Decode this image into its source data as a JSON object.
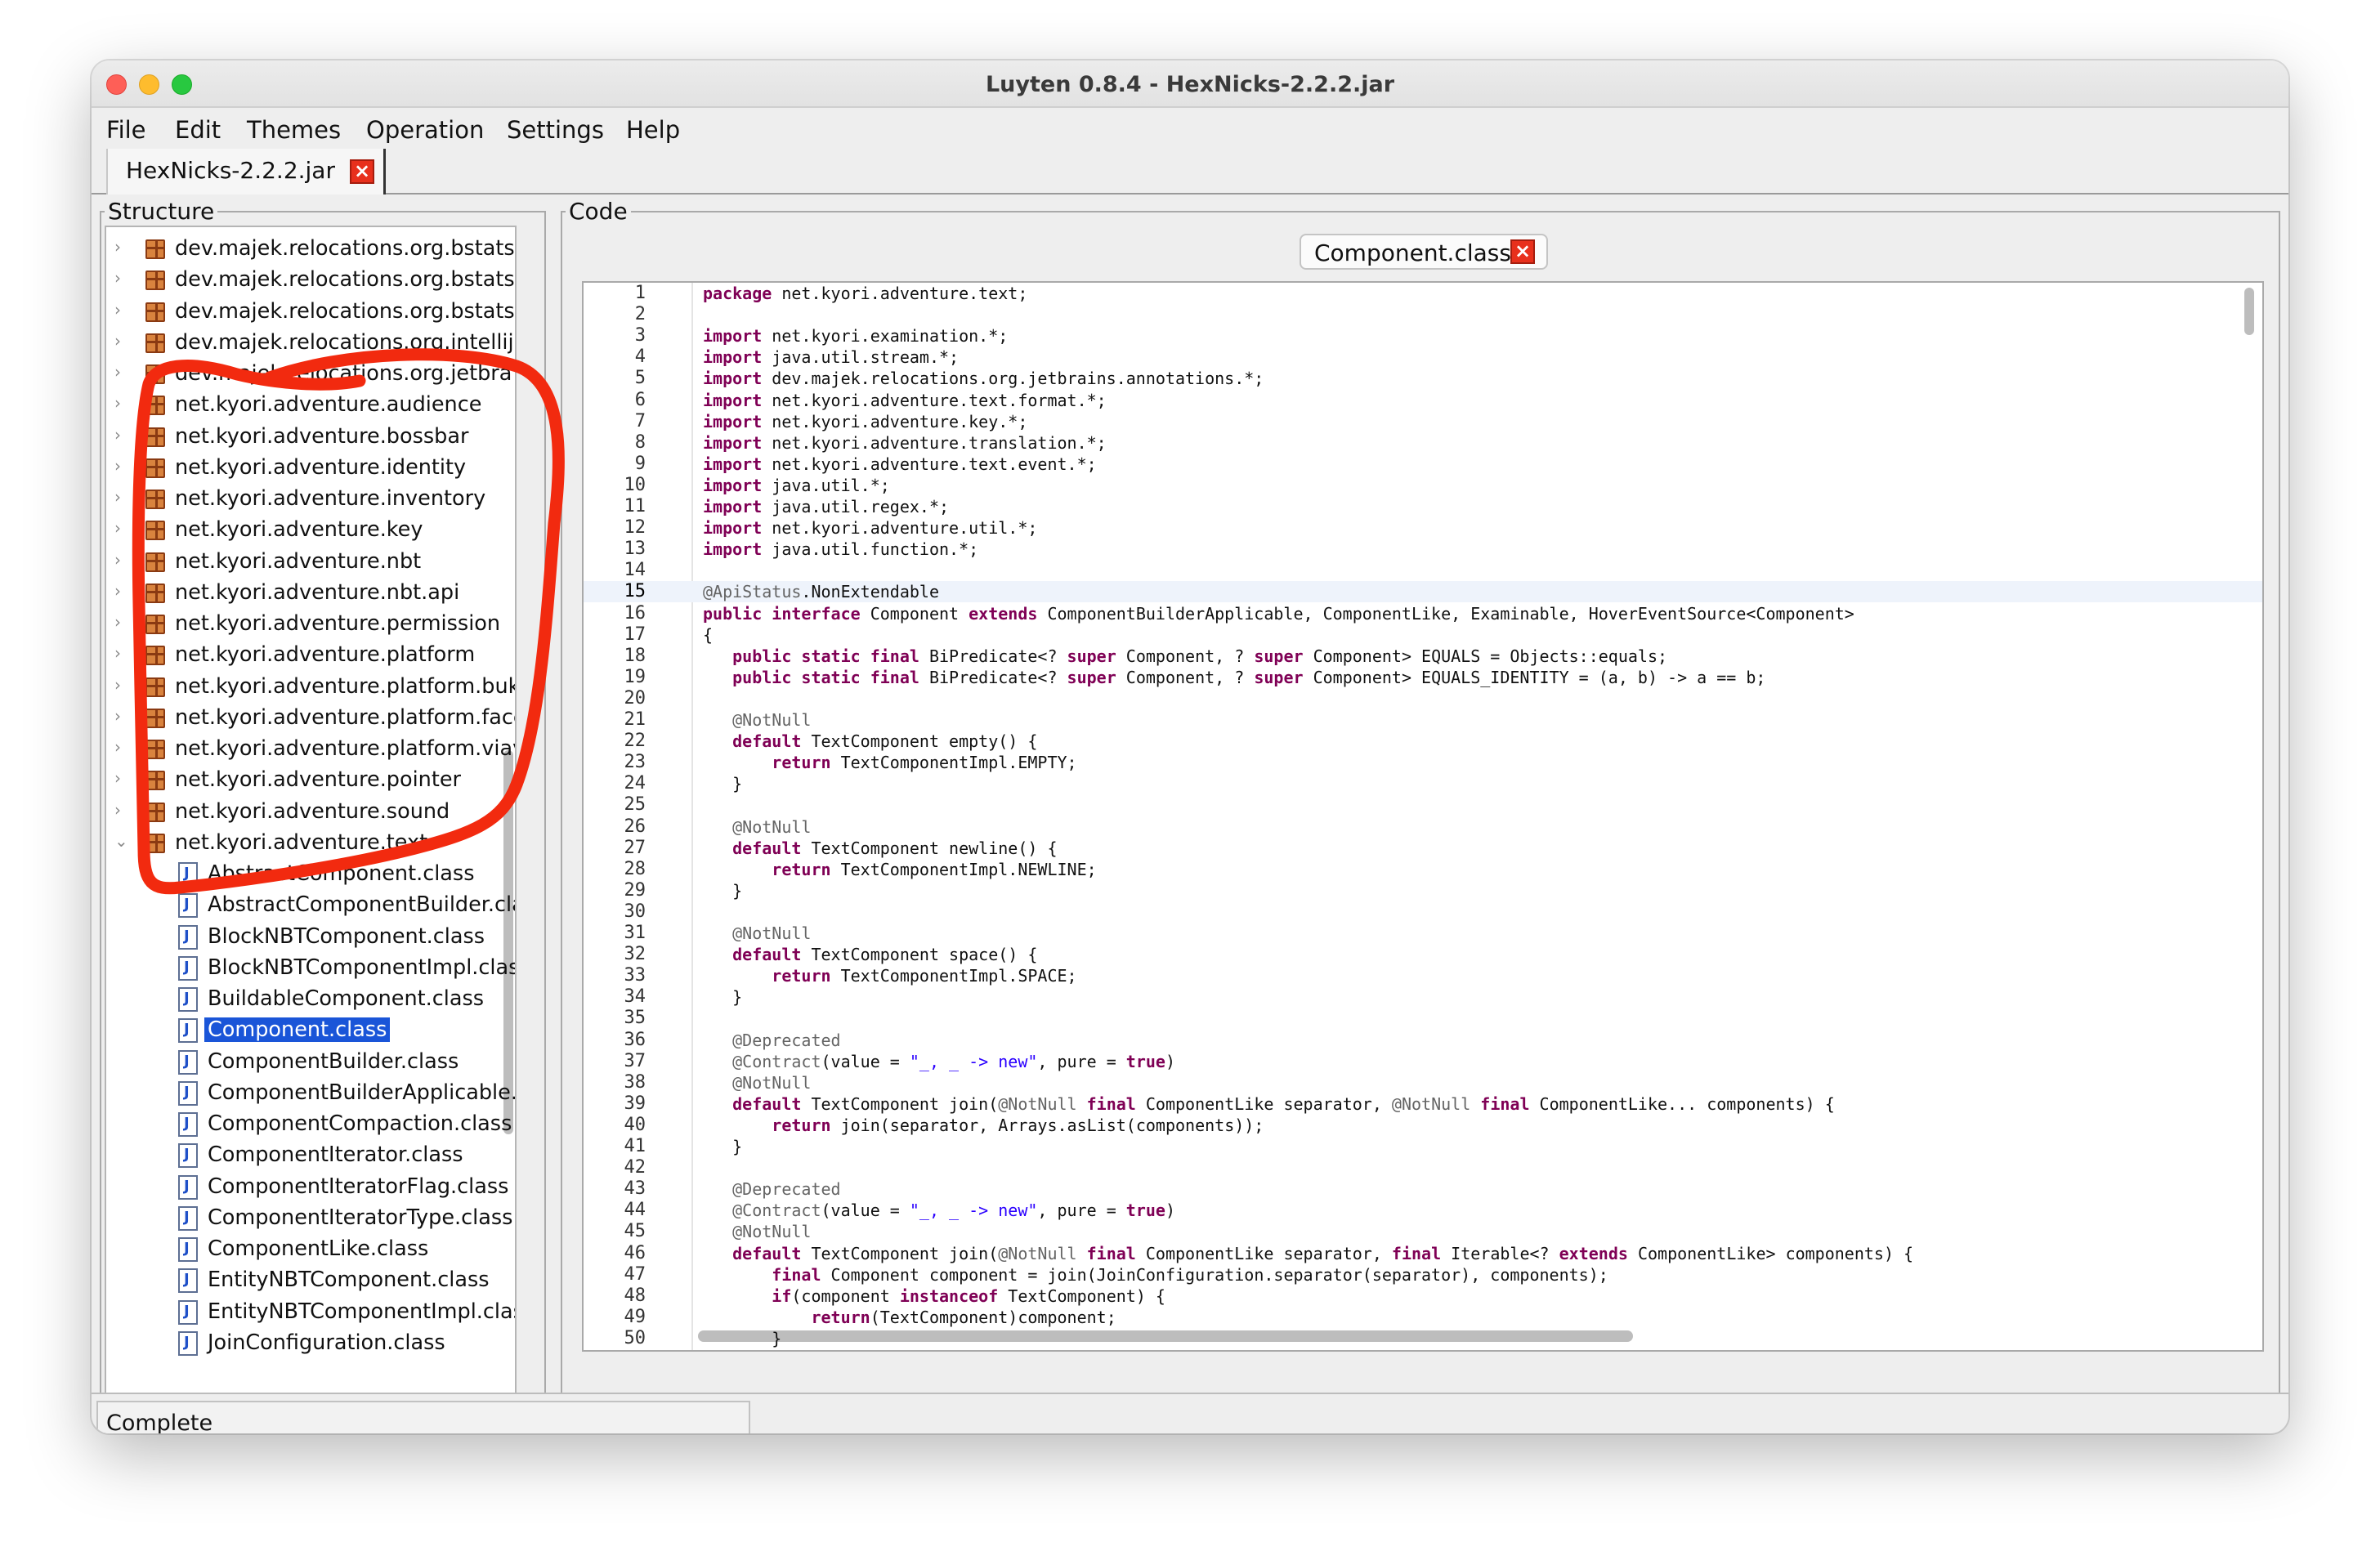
{
  "window": {
    "title": "Luyten 0.8.4 - HexNicks-2.2.2.jar"
  },
  "menu": [
    "File",
    "Edit",
    "Themes",
    "Operation",
    "Settings",
    "Help"
  ],
  "file_tab": {
    "label": "HexNicks-2.2.2.jar",
    "close": "×"
  },
  "structure": {
    "title": "Structure",
    "packages": [
      "dev.majek.relocations.org.bstats.b",
      "dev.majek.relocations.org.bstats.cl",
      "dev.majek.relocations.org.bstats.js",
      "dev.majek.relocations.org.intellij.la",
      "dev.majek.relocations.org.jetbra",
      "net.kyori.adventure.audience",
      "net.kyori.adventure.bossbar",
      "net.kyori.adventure.identity",
      "net.kyori.adventure.inventory",
      "net.kyori.adventure.key",
      "net.kyori.adventure.nbt",
      "net.kyori.adventure.nbt.api",
      "net.kyori.adventure.permission",
      "net.kyori.adventure.platform",
      "net.kyori.adventure.platform.bukki",
      "net.kyori.adventure.platform.facet",
      "net.kyori.adventure.platform.viaver",
      "net.kyori.adventure.pointer",
      "net.kyori.adventure.sound",
      "net.kyori.adventure.text"
    ],
    "classes": [
      "AbstractComponent.class",
      "AbstractComponentBuilder.class",
      "BlockNBTComponent.class",
      "BlockNBTComponentImpl.class",
      "BuildableComponent.class",
      "Component.class",
      "ComponentBuilder.class",
      "ComponentBuilderApplicable.cl",
      "ComponentCompaction.class",
      "ComponentIterator.class",
      "ComponentIteratorFlag.class",
      "ComponentIteratorType.class",
      "ComponentLike.class",
      "EntityNBTComponent.class",
      "EntityNBTComponentImpl.class",
      "JoinConfiguration.class"
    ],
    "selected": "Component.class"
  },
  "code_panel": {
    "title": "Code",
    "tab_label": "Component.class",
    "tab_close": "×",
    "current_line": 15,
    "lines": [
      [
        [
          "kw",
          "package"
        ],
        [
          "",
          "net.kyori.adventure.text;"
        ]
      ],
      [],
      [
        [
          "kw",
          "import"
        ],
        [
          "",
          "net.kyori.examination.*;"
        ]
      ],
      [
        [
          "kw",
          "import"
        ],
        [
          "",
          "java.util.stream.*;"
        ]
      ],
      [
        [
          "kw",
          "import"
        ],
        [
          "",
          "dev.majek.relocations.org.jetbrains.annotations.*;"
        ]
      ],
      [
        [
          "kw",
          "import"
        ],
        [
          "",
          "net.kyori.adventure.text.format.*;"
        ]
      ],
      [
        [
          "kw",
          "import"
        ],
        [
          "",
          "net.kyori.adventure.key.*;"
        ]
      ],
      [
        [
          "kw",
          "import"
        ],
        [
          "",
          "net.kyori.adventure.translation.*;"
        ]
      ],
      [
        [
          "kw",
          "import"
        ],
        [
          "",
          "net.kyori.adventure.text.event.*;"
        ]
      ],
      [
        [
          "kw",
          "import"
        ],
        [
          "",
          "java.util.*;"
        ]
      ],
      [
        [
          "kw",
          "import"
        ],
        [
          "",
          "java.util.regex.*;"
        ]
      ],
      [
        [
          "kw",
          "import"
        ],
        [
          "",
          "net.kyori.adventure.util.*;"
        ]
      ],
      [
        [
          "kw",
          "import"
        ],
        [
          "",
          "java.util.function.*;"
        ]
      ],
      [],
      [
        [
          "an",
          "@ApiStatus"
        ],
        [
          "",
          ".NonExtendable"
        ]
      ],
      [
        [
          "kw",
          "public interface"
        ],
        [
          "",
          "Component"
        ],
        [
          "kw",
          "extends"
        ],
        [
          "",
          "ComponentBuilderApplicable, ComponentLike, Examinable, HoverEventSource<Component>"
        ]
      ],
      [
        [
          "",
          "{"
        ]
      ],
      [
        [
          "",
          "   "
        ],
        [
          "kw",
          "public static final"
        ],
        [
          "",
          "BiPredicate<?"
        ],
        [
          "kw",
          "super"
        ],
        [
          "",
          "Component, ?"
        ],
        [
          "kw",
          "super"
        ],
        [
          "",
          "Component> EQUALS = Objects::equals;"
        ]
      ],
      [
        [
          "",
          "   "
        ],
        [
          "kw",
          "public static final"
        ],
        [
          "",
          "BiPredicate<?"
        ],
        [
          "kw",
          "super"
        ],
        [
          "",
          "Component, ?"
        ],
        [
          "kw",
          "super"
        ],
        [
          "",
          "Component> EQUALS_IDENTITY = (a, b) -> a == b;"
        ]
      ],
      [],
      [
        [
          "",
          "   "
        ],
        [
          "an",
          "@NotNull"
        ]
      ],
      [
        [
          "",
          "   "
        ],
        [
          "kw",
          "default"
        ],
        [
          "",
          "TextComponent empty() {"
        ]
      ],
      [
        [
          "",
          "       "
        ],
        [
          "kw",
          "return"
        ],
        [
          "",
          "TextComponentImpl.EMPTY;"
        ]
      ],
      [
        [
          "",
          "   }"
        ]
      ],
      [],
      [
        [
          "",
          "   "
        ],
        [
          "an",
          "@NotNull"
        ]
      ],
      [
        [
          "",
          "   "
        ],
        [
          "kw",
          "default"
        ],
        [
          "",
          "TextComponent newline() {"
        ]
      ],
      [
        [
          "",
          "       "
        ],
        [
          "kw",
          "return"
        ],
        [
          "",
          "TextComponentImpl.NEWLINE;"
        ]
      ],
      [
        [
          "",
          "   }"
        ]
      ],
      [],
      [
        [
          "",
          "   "
        ],
        [
          "an",
          "@NotNull"
        ]
      ],
      [
        [
          "",
          "   "
        ],
        [
          "kw",
          "default"
        ],
        [
          "",
          "TextComponent space() {"
        ]
      ],
      [
        [
          "",
          "       "
        ],
        [
          "kw",
          "return"
        ],
        [
          "",
          "TextComponentImpl.SPACE;"
        ]
      ],
      [
        [
          "",
          "   }"
        ]
      ],
      [],
      [
        [
          "",
          "   "
        ],
        [
          "an",
          "@Deprecated"
        ]
      ],
      [
        [
          "",
          "   "
        ],
        [
          "an",
          "@Contract"
        ],
        [
          "",
          "(value = "
        ],
        [
          "st",
          "\"_, _ -> new\""
        ],
        [
          "",
          ", pure = "
        ],
        [
          "kw",
          "true"
        ],
        [
          "",
          ")"
        ]
      ],
      [
        [
          "",
          "   "
        ],
        [
          "an",
          "@NotNull"
        ]
      ],
      [
        [
          "",
          "   "
        ],
        [
          "kw",
          "default"
        ],
        [
          "",
          "TextComponent join("
        ],
        [
          "an",
          "@NotNull"
        ],
        [
          "kw",
          "final"
        ],
        [
          "",
          "ComponentLike separator, "
        ],
        [
          "an",
          "@NotNull"
        ],
        [
          "kw",
          "final"
        ],
        [
          "",
          "ComponentLike... components) {"
        ]
      ],
      [
        [
          "",
          "       "
        ],
        [
          "kw",
          "return"
        ],
        [
          "",
          "join(separator, Arrays.asList(components));"
        ]
      ],
      [
        [
          "",
          "   }"
        ]
      ],
      [],
      [
        [
          "",
          "   "
        ],
        [
          "an",
          "@Deprecated"
        ]
      ],
      [
        [
          "",
          "   "
        ],
        [
          "an",
          "@Contract"
        ],
        [
          "",
          "(value = "
        ],
        [
          "st",
          "\"_, _ -> new\""
        ],
        [
          "",
          ", pure = "
        ],
        [
          "kw",
          "true"
        ],
        [
          "",
          ")"
        ]
      ],
      [
        [
          "",
          "   "
        ],
        [
          "an",
          "@NotNull"
        ]
      ],
      [
        [
          "",
          "   "
        ],
        [
          "kw",
          "default"
        ],
        [
          "",
          "TextComponent join("
        ],
        [
          "an",
          "@NotNull"
        ],
        [
          "kw",
          "final"
        ],
        [
          "",
          "ComponentLike separator, "
        ],
        [
          "kw",
          "final"
        ],
        [
          "",
          "Iterable<?"
        ],
        [
          "kw",
          "extends"
        ],
        [
          "",
          "ComponentLike> components) {"
        ]
      ],
      [
        [
          "",
          "       "
        ],
        [
          "kw",
          "final"
        ],
        [
          "",
          "Component component = join(JoinConfiguration.separator(separator), components);"
        ]
      ],
      [
        [
          "",
          "       "
        ],
        [
          "kw",
          "if"
        ],
        [
          "",
          "(component "
        ],
        [
          "kw",
          "instanceof"
        ],
        [
          "",
          "TextComponent) {"
        ]
      ],
      [
        [
          "",
          "           "
        ],
        [
          "kw",
          "return"
        ],
        [
          "",
          "(TextComponent)component;"
        ]
      ],
      [
        [
          "",
          "       }"
        ]
      ]
    ]
  },
  "status": {
    "text": "Complete"
  },
  "colors": {
    "keyword": "#7f0055",
    "annotation": "#646464",
    "string": "#2a00ff",
    "selection": "#1a55d8",
    "annotation_stroke": "#f22a0f"
  }
}
